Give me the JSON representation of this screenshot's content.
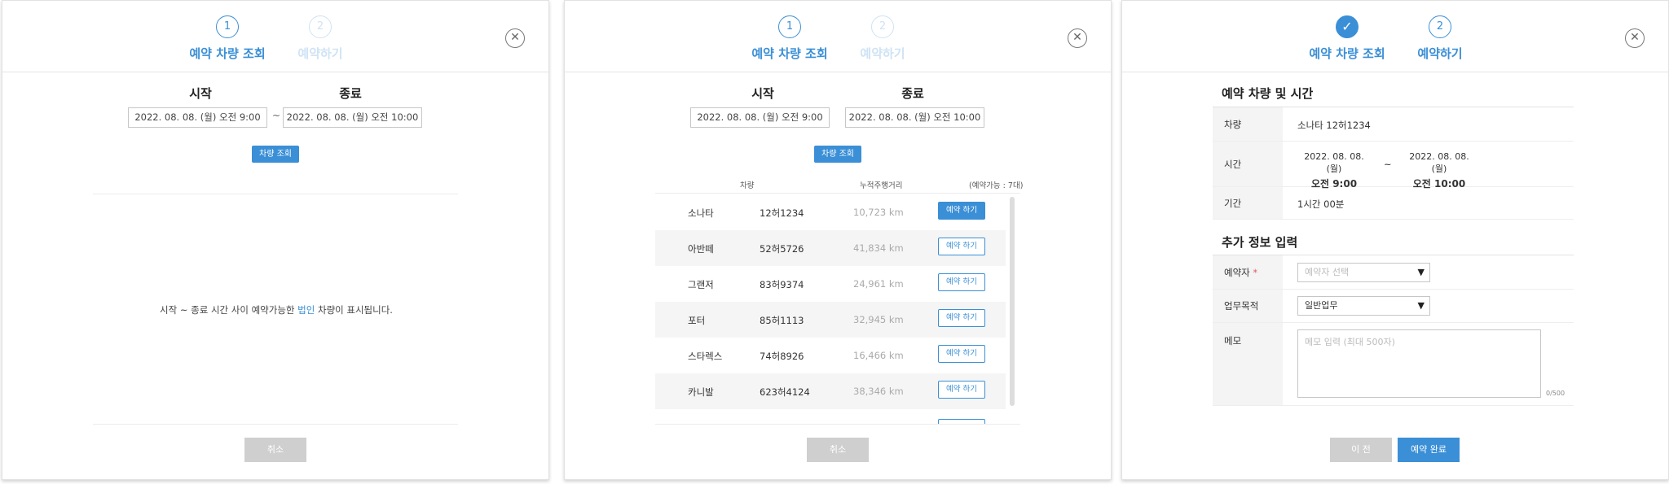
{
  "steps": {
    "step1_number": "1",
    "step1_label": "예약 차량 조회",
    "step2_number": "2",
    "step2_label": "예약하기",
    "done_icon": "check-icon"
  },
  "close_icon": "close-icon",
  "close_glyph": "✕",
  "check_glyph": "✓",
  "search": {
    "start_label": "시작",
    "end_label": "종료",
    "start_value": "2022. 08. 08. (월)    오전 9:00",
    "end_value": "2022. 08. 08. (월)    오전 10:00",
    "tilde": "~",
    "search_button": "차량 조회"
  },
  "empty_message": {
    "before": "시작 ~ 종료 시간 사이 예약가능한 ",
    "highlight": "법인",
    "after": " 차량이 표시됩니다."
  },
  "cancel_button": "취소",
  "vehicle_list": {
    "col_vehicle": "차량",
    "col_mileage": "누적주행거리",
    "available": "(예약가능 : 7대)",
    "reserve_label": "예약 하기",
    "rows": [
      {
        "name": "소나타",
        "plate": "12허1234",
        "km": "10,723 km"
      },
      {
        "name": "아반떼",
        "plate": "52허5726",
        "km": "41,834 km"
      },
      {
        "name": "그랜저",
        "plate": "83허9374",
        "km": "24,961 km"
      },
      {
        "name": "포터",
        "plate": "85허1113",
        "km": "32,945 km"
      },
      {
        "name": "스타렉스",
        "plate": "74허8926",
        "km": "16,466 km"
      },
      {
        "name": "카니발",
        "plate": "623허4124",
        "km": "38,346 km"
      }
    ]
  },
  "reservation": {
    "section_title": "예약 차량 및 시간",
    "vehicle_key": "차량",
    "vehicle_value": "소나타 12허1234",
    "time_key": "시간",
    "start_date": "2022. 08. 08. (월)",
    "start_time": "오전 9:00",
    "tilde": "~",
    "end_date": "2022. 08. 08. (월)",
    "end_time": "오전 10:00",
    "period_key": "기간",
    "period_value": "1시간 00분"
  },
  "extra": {
    "section_title": "추가 정보 입력",
    "reserver_key": "예약자",
    "required_mark": "*",
    "reserver_placeholder": "예약자 선택",
    "purpose_key": "업무목적",
    "purpose_value": "일반업무",
    "dropdown_arrow": "▼",
    "memo_key": "메모",
    "memo_placeholder": "메모 입력 (최대 500자)",
    "memo_count": "0/500"
  },
  "footer": {
    "prev_button": "이 전",
    "complete_button": "예약 완료"
  }
}
